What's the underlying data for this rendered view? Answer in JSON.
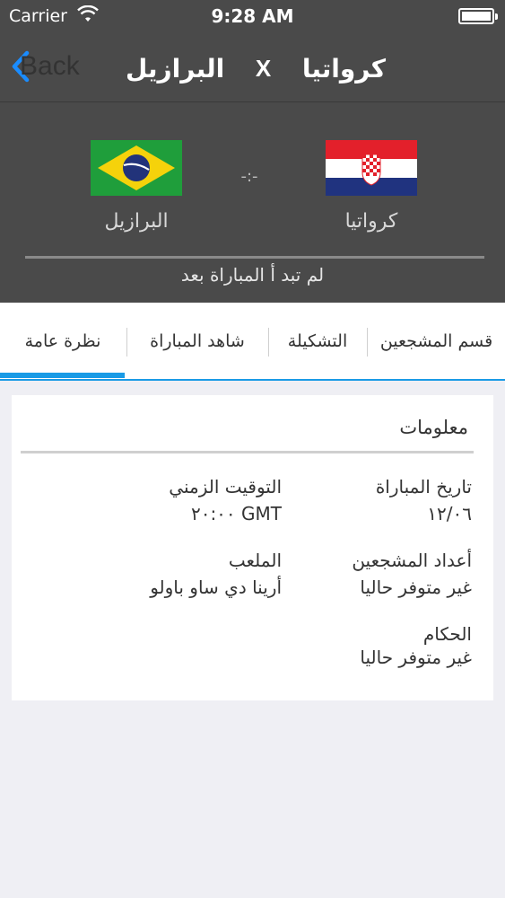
{
  "status_bar": {
    "carrier": "Carrier",
    "time": "9:28 AM",
    "battery_level": 1.0
  },
  "nav": {
    "back_label": "Back",
    "title_home": "البرازيل",
    "title_sep": "X",
    "title_away": "كرواتيا"
  },
  "match": {
    "home_team": "البرازيل",
    "away_team": "كرواتيا",
    "score": "-:-",
    "status": "لم تبد أ المباراة بعد"
  },
  "tabs": [
    {
      "label": "نظرة عامة",
      "active": true
    },
    {
      "label": "شاهد المباراة",
      "active": false
    },
    {
      "label": "التشكيلة",
      "active": false
    },
    {
      "label": "قسم المشجعين",
      "active": false
    }
  ],
  "info": {
    "title": "معلومات",
    "match_date_label": "تاريخ المباراة",
    "match_date_value": "١٢/٠٦",
    "time_label": "التوقيت الزمني",
    "time_value": "٢٠:٠٠ GMT",
    "fans_label": "أعداد المشجعين",
    "fans_value": "غير متوفر حاليا",
    "stadium_label": "الملعب",
    "stadium_value": "أرينا دي ساو باولو",
    "referees_label": "الحكام",
    "referees_value": "غير متوفر حاليا"
  },
  "colors": {
    "header_bg": "#4a4a4a",
    "accent": "#1a9be6",
    "back_blue": "#1a8cff"
  }
}
